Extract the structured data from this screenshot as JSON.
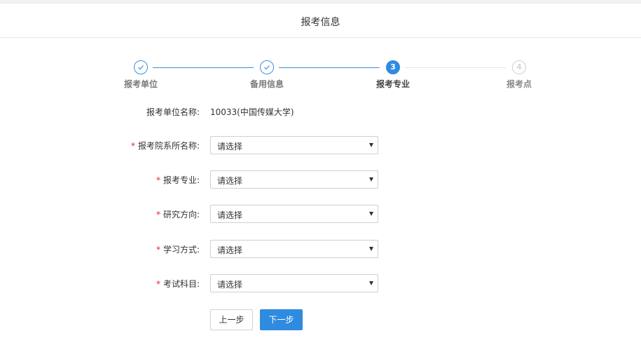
{
  "header": {
    "title": "报考信息"
  },
  "steps": [
    {
      "label": "报考单位",
      "number": "1",
      "state": "done"
    },
    {
      "label": "备用信息",
      "number": "2",
      "state": "done"
    },
    {
      "label": "报考专业",
      "number": "3",
      "state": "active"
    },
    {
      "label": "报考点",
      "number": "4",
      "state": "todo"
    }
  ],
  "form": {
    "unit_name": {
      "label": "报考单位名称:",
      "value": "10033(中国传媒大学)"
    },
    "department": {
      "label": "报考院系所名称:",
      "required": "*",
      "value": "请选择"
    },
    "major": {
      "label": "报考专业:",
      "required": "*",
      "value": "请选择"
    },
    "direction": {
      "label": "研究方向:",
      "required": "*",
      "value": "请选择"
    },
    "study_mode": {
      "label": "学习方式:",
      "required": "*",
      "value": "请选择"
    },
    "exam_subjects": {
      "label": "考试科目:",
      "required": "*",
      "value": "请选择"
    }
  },
  "buttons": {
    "prev": "上一步",
    "next": "下一步"
  },
  "colors": {
    "accent": "#2f8be0",
    "required": "#d9282e"
  }
}
